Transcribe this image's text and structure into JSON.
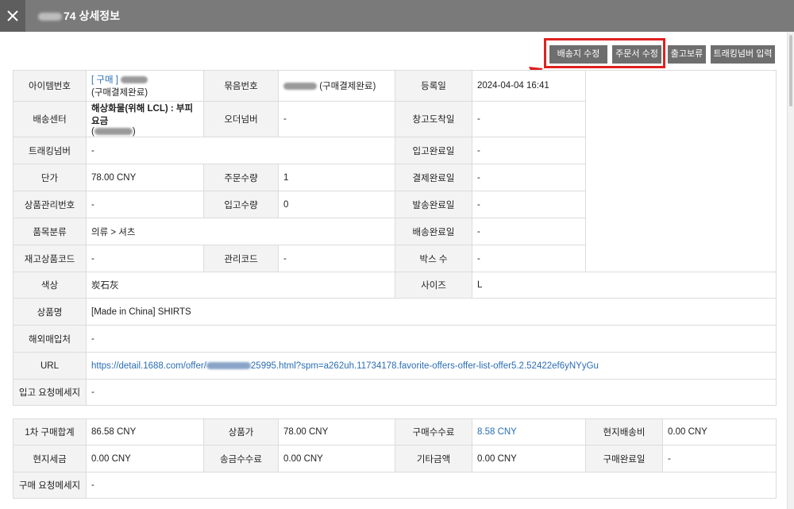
{
  "window": {
    "title_suffix": "74 상세정보"
  },
  "toolbar": {
    "buttons": [
      "배송지 수정",
      "주문서 수정",
      "출고보류",
      "트래킹넘버 입력"
    ]
  },
  "detail": {
    "labels": {
      "item_no": "아이템번호",
      "bundle_no": "묶음번호",
      "reg_date": "등록일",
      "shipping_center": "배송센터",
      "order_no": "오더넘버",
      "warehouse_arrival": "창고도착일",
      "tracking_no": "트래킹넘버",
      "stock_in_done": "입고완료일",
      "unit_price": "단가",
      "order_qty": "주문수량",
      "payment_done": "결제완료일",
      "product_mgmt_no": "상품관리번호",
      "stock_in_qty": "입고수량",
      "ship_done": "발송완료일",
      "category": "품목분류",
      "delivery_done": "배송완료일",
      "stock_code": "재고상품코드",
      "mgmt_code": "관리코드",
      "box_count": "박스 수",
      "color": "색상",
      "size": "사이즈",
      "product_name": "상품명",
      "overseas_vendor": "해외매입처",
      "url": "URL",
      "stock_in_message": "입고 요청메세지"
    },
    "values": {
      "item_tag": "[ 구매 ]",
      "item_status": "(구매결제완료)",
      "bundle_status": "(구매결제완료)",
      "reg_date": "2024-04-04 16:41",
      "shipping_center": "해상화물(위해 LCL) : 부피요금",
      "shipping_center_paren_open": "(",
      "shipping_center_paren_close": ")",
      "order_no": "-",
      "warehouse_arrival": "-",
      "tracking_no": "-",
      "stock_in_done": "-",
      "unit_price": "78.00 CNY",
      "order_qty": "1",
      "payment_done": "-",
      "product_mgmt_no": "-",
      "stock_in_qty": "0",
      "ship_done": "-",
      "category": "의류 > 셔츠",
      "delivery_done": "-",
      "stock_code": "-",
      "mgmt_code": "-",
      "box_count": "-",
      "color": "炭石灰",
      "size": "L",
      "product_name": "[Made in China] SHIRTS",
      "overseas_vendor": "-",
      "url_prefix": "https://detail.1688.com/offer/",
      "url_suffix": "25995.html?spm=a262uh.11734178.favorite-offers-offer-list-offer5.2.52422ef6yNYyGu",
      "stock_in_message": "-"
    }
  },
  "purchase": {
    "labels": {
      "first_total": "1차 구매합계",
      "product_price": "상품가",
      "purchase_fee": "구매수수료",
      "local_shipping": "현지배송비",
      "local_tax": "현지세금",
      "remit_fee": "송금수수료",
      "other_amount": "기타금액",
      "purchase_done": "구매완료일",
      "purchase_message": "구매 요청메세지"
    },
    "values": {
      "first_total": "86.58 CNY",
      "product_price": "78.00 CNY",
      "purchase_fee": "8.58 CNY",
      "local_shipping": "0.00 CNY",
      "local_tax": "0.00 CNY",
      "remit_fee": "0.00 CNY",
      "other_amount": "0.00 CNY",
      "purchase_done": "-",
      "purchase_message": "-"
    }
  },
  "colors": {
    "titlebar": "#7a7a7a",
    "button": "#6e6e6e",
    "highlight": "#e02020",
    "link": "#2a6db5",
    "label_bg": "#f3f3f3"
  }
}
